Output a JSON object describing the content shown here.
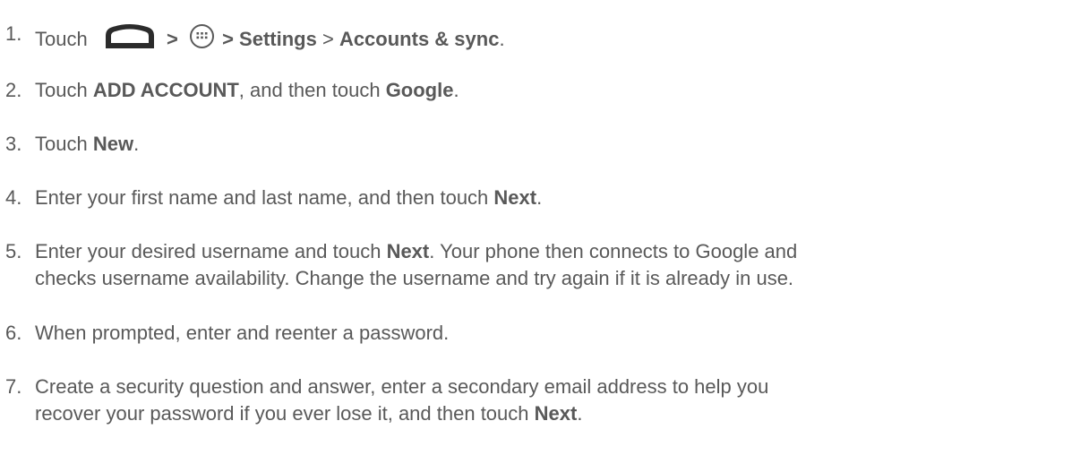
{
  "icons": {
    "home": "home-icon",
    "apps": "apps-icon",
    "color": "#2b2b2b"
  },
  "steps": [
    {
      "num": "1.",
      "touch": "Touch",
      "sep1": ">",
      "sep2": "> Settings",
      "sep3": ">",
      "accounts": "Accounts & sync",
      "end": "."
    },
    {
      "num": "2.",
      "a": "Touch ",
      "b1": "ADD ACCOUNT",
      "c": ", and then touch ",
      "b2": "Google",
      "d": "."
    },
    {
      "num": "3.",
      "a": "Touch ",
      "b1": "New",
      "d": "."
    },
    {
      "num": "4.",
      "a": "Enter your first name and last name, and then touch ",
      "b1": "Next",
      "d": "."
    },
    {
      "num": "5.",
      "a": "Enter your desired username and touch ",
      "b1": "Next",
      "c": ". Your phone then connects to Google and",
      "line2": "checks username availability. Change the username and try again if it is already in use."
    },
    {
      "num": "6.",
      "a": "When prompted, enter and reenter a password."
    },
    {
      "num": "7.",
      "a": "Create a security question and answer, enter a secondary email address to help you",
      "line2": "recover your password if you ever lose it, and then touch ",
      "b1": "Next",
      "d": "."
    }
  ]
}
